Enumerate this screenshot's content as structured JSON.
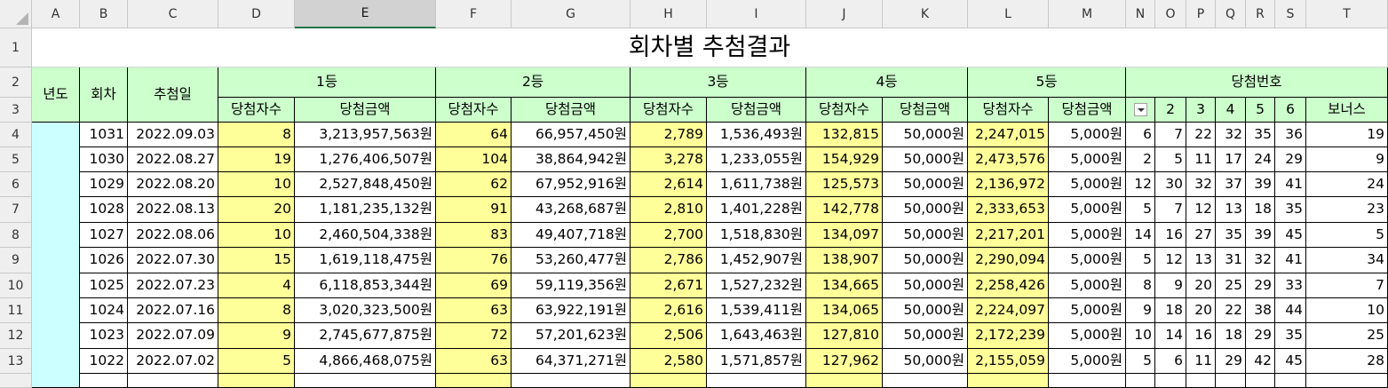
{
  "columns": [
    "A",
    "B",
    "C",
    "D",
    "E",
    "F",
    "G",
    "H",
    "I",
    "J",
    "K",
    "L",
    "M",
    "N",
    "O",
    "P",
    "Q",
    "R",
    "S",
    "T"
  ],
  "selected_column": "E",
  "rows": [
    "1",
    "2",
    "3",
    "4",
    "5",
    "6",
    "7",
    "8",
    "9",
    "10",
    "11",
    "12",
    "13"
  ],
  "title": "회차별 추첨결과",
  "headers": {
    "year": "년도",
    "round": "회차",
    "draw_date": "추첨일",
    "rank1": "1등",
    "rank2": "2등",
    "rank3": "3등",
    "rank4": "4등",
    "rank5": "5등",
    "numbers": "당첨번호",
    "winners": "당첨자수",
    "amount": "당첨금액",
    "num_cols": [
      "",
      "2",
      "3",
      "4",
      "5",
      "6",
      "보너스"
    ]
  },
  "table": [
    {
      "round": "1031",
      "date": "2022.09.03",
      "w1": "8",
      "a1": "3,213,957,563원",
      "w2": "64",
      "a2": "66,957,450원",
      "w3": "2,789",
      "a3": "1,536,493원",
      "w4": "132,815",
      "a4": "50,000원",
      "w5": "2,247,015",
      "a5": "5,000원",
      "nums": [
        "6",
        "7",
        "22",
        "32",
        "35",
        "36",
        "19"
      ]
    },
    {
      "round": "1030",
      "date": "2022.08.27",
      "w1": "19",
      "a1": "1,276,406,507원",
      "w2": "104",
      "a2": "38,864,942원",
      "w3": "3,278",
      "a3": "1,233,055원",
      "w4": "154,929",
      "a4": "50,000원",
      "w5": "2,473,576",
      "a5": "5,000원",
      "nums": [
        "2",
        "5",
        "11",
        "17",
        "24",
        "29",
        "9"
      ]
    },
    {
      "round": "1029",
      "date": "2022.08.20",
      "w1": "10",
      "a1": "2,527,848,450원",
      "w2": "62",
      "a2": "67,952,916원",
      "w3": "2,614",
      "a3": "1,611,738원",
      "w4": "125,573",
      "a4": "50,000원",
      "w5": "2,136,972",
      "a5": "5,000원",
      "nums": [
        "12",
        "30",
        "32",
        "37",
        "39",
        "41",
        "24"
      ]
    },
    {
      "round": "1028",
      "date": "2022.08.13",
      "w1": "20",
      "a1": "1,181,235,132원",
      "w2": "91",
      "a2": "43,268,687원",
      "w3": "2,810",
      "a3": "1,401,228원",
      "w4": "142,778",
      "a4": "50,000원",
      "w5": "2,333,653",
      "a5": "5,000원",
      "nums": [
        "5",
        "7",
        "12",
        "13",
        "18",
        "35",
        "23"
      ]
    },
    {
      "round": "1027",
      "date": "2022.08.06",
      "w1": "10",
      "a1": "2,460,504,338원",
      "w2": "83",
      "a2": "49,407,718원",
      "w3": "2,700",
      "a3": "1,518,830원",
      "w4": "134,097",
      "a4": "50,000원",
      "w5": "2,217,201",
      "a5": "5,000원",
      "nums": [
        "14",
        "16",
        "27",
        "35",
        "39",
        "45",
        "5"
      ]
    },
    {
      "round": "1026",
      "date": "2022.07.30",
      "w1": "15",
      "a1": "1,619,118,475원",
      "w2": "76",
      "a2": "53,260,477원",
      "w3": "2,786",
      "a3": "1,452,907원",
      "w4": "138,907",
      "a4": "50,000원",
      "w5": "2,290,094",
      "a5": "5,000원",
      "nums": [
        "5",
        "12",
        "13",
        "31",
        "32",
        "41",
        "34"
      ]
    },
    {
      "round": "1025",
      "date": "2022.07.23",
      "w1": "4",
      "a1": "6,118,853,344원",
      "w2": "69",
      "a2": "59,119,356원",
      "w3": "2,671",
      "a3": "1,527,232원",
      "w4": "134,665",
      "a4": "50,000원",
      "w5": "2,258,426",
      "a5": "5,000원",
      "nums": [
        "8",
        "9",
        "20",
        "25",
        "29",
        "33",
        "7"
      ]
    },
    {
      "round": "1024",
      "date": "2022.07.16",
      "w1": "8",
      "a1": "3,020,323,500원",
      "w2": "63",
      "a2": "63,922,191원",
      "w3": "2,616",
      "a3": "1,539,411원",
      "w4": "134,065",
      "a4": "50,000원",
      "w5": "2,224,097",
      "a5": "5,000원",
      "nums": [
        "9",
        "18",
        "20",
        "22",
        "38",
        "44",
        "10"
      ]
    },
    {
      "round": "1023",
      "date": "2022.07.09",
      "w1": "9",
      "a1": "2,745,677,875원",
      "w2": "72",
      "a2": "57,201,623원",
      "w3": "2,506",
      "a3": "1,643,463원",
      "w4": "127,810",
      "a4": "50,000원",
      "w5": "2,172,239",
      "a5": "5,000원",
      "nums": [
        "10",
        "14",
        "16",
        "18",
        "29",
        "35",
        "25"
      ]
    },
    {
      "round": "1022",
      "date": "2022.07.02",
      "w1": "5",
      "a1": "4,866,468,075원",
      "w2": "63",
      "a2": "64,371,271원",
      "w3": "2,580",
      "a3": "1,571,857원",
      "w4": "127,962",
      "a4": "50,000원",
      "w5": "2,155,059",
      "a5": "5,000원",
      "nums": [
        "5",
        "6",
        "11",
        "29",
        "42",
        "45",
        "28"
      ]
    }
  ]
}
